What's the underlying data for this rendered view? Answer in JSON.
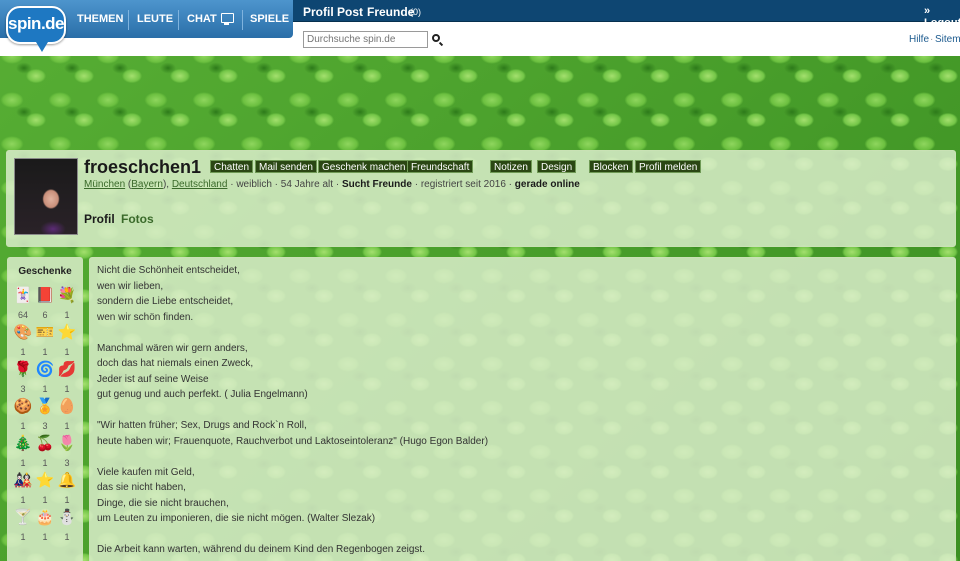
{
  "nav": {
    "logo": "spin.de",
    "themen": "THEMEN",
    "leute": "LEUTE",
    "chat": "CHAT",
    "spiele": "SPIELE"
  },
  "topbar": {
    "profil": "Profil",
    "post": "Post",
    "freunde": "Freunde",
    "freunde_count": "(0)",
    "logout": "» Logout",
    "hilfe": "Hilfe",
    "sitemap": "Sitemap"
  },
  "search": {
    "placeholder": "Durchsuche spin.de"
  },
  "profile": {
    "username": "froeschchen1",
    "actions": [
      "Chatten",
      "Mail senden",
      "Geschenk machen",
      "Freundschaft",
      "Notizen",
      "Design",
      "Blocken",
      "Profil melden"
    ],
    "city": "München",
    "region": "Bayern",
    "country": "Deutschland",
    "gender": "weiblich",
    "age": "54 Jahre alt",
    "seeking": "Sucht Freunde",
    "registered": "registriert seit 2016",
    "online": "gerade online",
    "tabs": [
      "Profil",
      "Fotos"
    ]
  },
  "gifts": {
    "title": "Geschenke",
    "items": [
      {
        "icon": "🃏",
        "count": "64"
      },
      {
        "icon": "📕",
        "count": "6"
      },
      {
        "icon": "💐",
        "count": "1"
      },
      {
        "icon": "🎨",
        "count": "1"
      },
      {
        "icon": "🎫",
        "count": "1"
      },
      {
        "icon": "⭐",
        "count": "1"
      },
      {
        "icon": "🌹",
        "count": "3"
      },
      {
        "icon": "🌀",
        "count": "1"
      },
      {
        "icon": "💋",
        "count": "1"
      },
      {
        "icon": "🍪",
        "count": "1"
      },
      {
        "icon": "🏅",
        "count": "3"
      },
      {
        "icon": "🥚",
        "count": "1"
      },
      {
        "icon": "🎄",
        "count": "1"
      },
      {
        "icon": "🍒",
        "count": "1"
      },
      {
        "icon": "🌷",
        "count": "3"
      },
      {
        "icon": "🎎",
        "count": "1"
      },
      {
        "icon": "⭐",
        "count": "1"
      },
      {
        "icon": "🔔",
        "count": "1"
      },
      {
        "icon": "🍸",
        "count": "1"
      },
      {
        "icon": "🎂",
        "count": "1"
      },
      {
        "icon": "⛄",
        "count": "1"
      }
    ]
  },
  "about": {
    "lines": [
      "Nicht die Schönheit entscheidet,",
      "wen wir lieben,",
      "sondern die Liebe entscheidet,",
      "wen wir schön finden.",
      "",
      "Manchmal wären wir gern anders,",
      "doch das hat niemals einen Zweck,",
      "Jeder ist auf seine Weise",
      "gut genug und auch perfekt. ( Julia Engelmann)",
      "",
      "\"Wir hatten früher; Sex, Drugs and Rock`n Roll,",
      "heute haben wir; Frauenquote, Rauchverbot und Laktoseintoleranz\" (Hugo Egon Balder)",
      "",
      "Viele kaufen mit Geld,",
      "das sie nicht haben,",
      "Dinge, die sie nicht brauchen,",
      "um Leuten zu imponieren, die sie nicht mögen. (Walter Slezak)",
      "",
      "Die Arbeit kann warten, während du deinem Kind den Regenbogen zeigst."
    ]
  },
  "colors": {
    "nav_dark": "#0e4672",
    "nav_blue": "#2a6ea8",
    "action_btn": "#2a4713",
    "panel": "#dceecd",
    "link_green": "#3a6a2a"
  }
}
